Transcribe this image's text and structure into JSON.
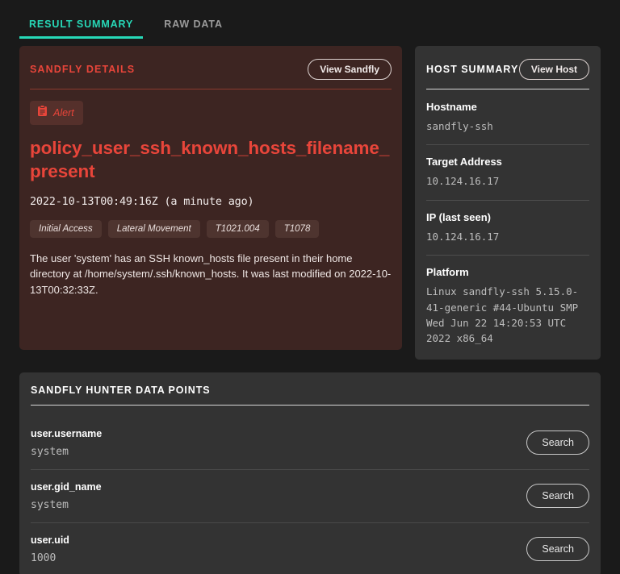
{
  "tabs": [
    {
      "label": "RESULT SUMMARY",
      "active": true
    },
    {
      "label": "RAW DATA",
      "active": false
    }
  ],
  "colors": {
    "page_background": "#1a1a1a",
    "accent_teal": "#27d9b8",
    "alert_red": "#e8453a",
    "sandfly_panel_background": "#3d2522",
    "panel_background": "#333333"
  },
  "sandfly_details": {
    "header": "SANDFLY DETAILS",
    "view_button": "View Sandfly",
    "badge": {
      "icon": "clipboard-icon",
      "label": "Alert"
    },
    "title": "policy_user_ssh_known_hosts_filename_present",
    "timestamp": "2022-10-13T00:49:16Z (a minute ago)",
    "tags": [
      "Initial Access",
      "Lateral Movement",
      "T1021.004",
      "T1078"
    ],
    "description": "The user 'system' has an SSH known_hosts file present in their home directory at /home/system/.ssh/known_hosts. It was last modified on 2022-10-13T00:32:33Z."
  },
  "host_summary": {
    "header": "HOST SUMMARY",
    "view_button": "View Host",
    "fields": [
      {
        "label": "Hostname",
        "value": "sandfly-ssh"
      },
      {
        "label": "Target Address",
        "value": "10.124.16.17"
      },
      {
        "label": "IP (last seen)",
        "value": "10.124.16.17"
      },
      {
        "label": "Platform",
        "value": "Linux sandfly-ssh 5.15.0-41-generic #44-Ubuntu SMP Wed Jun 22 14:20:53 UTC 2022 x86_64"
      }
    ]
  },
  "hunter_data_points": {
    "header": "SANDFLY HUNTER DATA POINTS",
    "search_label": "Search",
    "rows": [
      {
        "key": "user.username",
        "value": "system"
      },
      {
        "key": "user.gid_name",
        "value": "system"
      },
      {
        "key": "user.uid",
        "value": "1000"
      }
    ]
  }
}
